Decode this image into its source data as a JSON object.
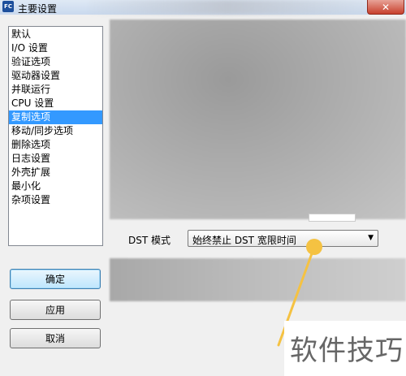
{
  "window": {
    "app_icon_text": "FC",
    "title": "主要设置",
    "close_label": "✕"
  },
  "sidebar": {
    "selected_index": 6,
    "items": [
      {
        "label": "默认"
      },
      {
        "label": "I/O 设置"
      },
      {
        "label": "验证选项"
      },
      {
        "label": "驱动器设置"
      },
      {
        "label": "并联运行"
      },
      {
        "label": "CPU 设置"
      },
      {
        "label": "复制选项"
      },
      {
        "label": "移动/同步选项"
      },
      {
        "label": "删除选项"
      },
      {
        "label": "日志设置"
      },
      {
        "label": "外壳扩展"
      },
      {
        "label": "最小化"
      },
      {
        "label": "杂项设置"
      }
    ]
  },
  "dst": {
    "label": "DST 模式",
    "selected_value": "始终禁止 DST 宽限时间",
    "dropdown_icon": "chevron-down-icon"
  },
  "buttons": {
    "ok": "确定",
    "apply": "应用",
    "cancel": "取消"
  },
  "watermark": {
    "text": "软件技巧"
  },
  "colors": {
    "selection": "#3399ff",
    "annotation": "#f5c242"
  }
}
